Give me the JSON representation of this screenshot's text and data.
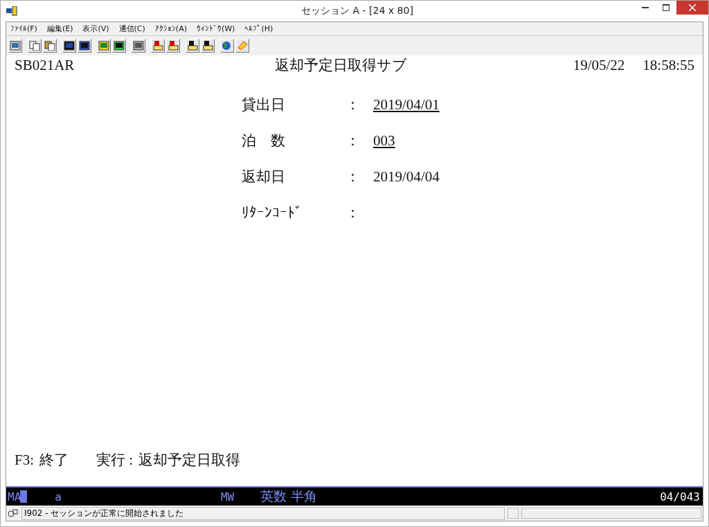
{
  "window": {
    "title": "セッション A - [24 x 80]"
  },
  "menu": [
    "ﾌｧｲﾙ(F)",
    "編集(E)",
    "表示(V)",
    "通信(C)",
    "ｱｸｼｮﾝ(A)",
    "ｳｨﾝﾄﾞｳ(W)",
    "ﾍﾙﾌﾟ(H)"
  ],
  "screen": {
    "program_id": "SB021AR",
    "heading": "返却予定日取得サブ",
    "date": "19/05/22",
    "time": "18:58:55",
    "fields": [
      {
        "label": "貸出日",
        "separator": "：",
        "value": "2019/04/01",
        "kind": "input"
      },
      {
        "label": "泊　数",
        "separator": "：",
        "value": "003",
        "kind": "input"
      },
      {
        "label": "返却日",
        "separator": "：",
        "value": "2019/04/04",
        "kind": "output"
      },
      {
        "label": "ﾘﾀｰﾝｺｰﾄﾞ",
        "separator": "：",
        "kind": "output"
      }
    ],
    "function_keys": [
      {
        "key": "F3:",
        "action": "終了"
      },
      {
        "key": "実行 :",
        "action": "返却予定日取得"
      }
    ]
  },
  "oia": {
    "mode": "MA",
    "cursor": "a",
    "shift": "MW",
    "input_mode": "英数 半角",
    "position": "04/043"
  },
  "status_bar": {
    "message": "I902 - セッションが正常に開始されました"
  }
}
